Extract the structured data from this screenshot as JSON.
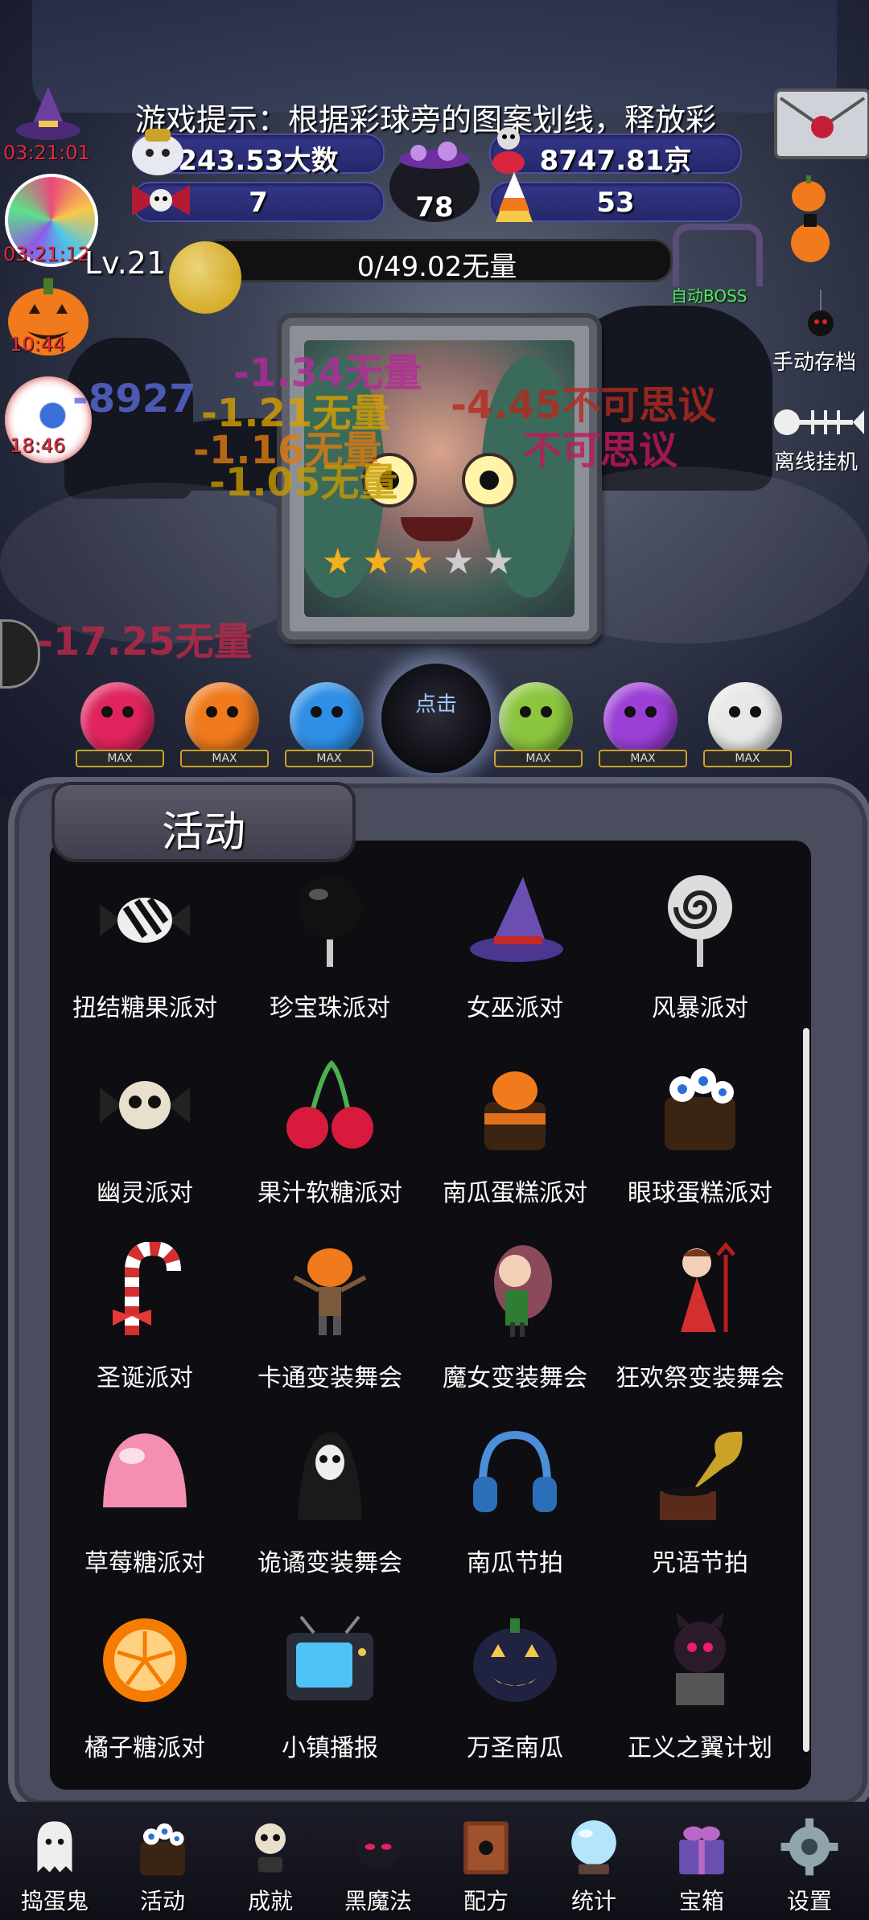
{
  "tip": "游戏提示：根据彩球旁的图案划线，释放彩",
  "timers": {
    "t1": "03:21:01",
    "t2": "03:21:12",
    "t3": "10:44",
    "t4": "18:46"
  },
  "stats": {
    "gold": "243.53大数",
    "souls": "8747.81京",
    "bows": "7",
    "cauldron": "78",
    "candy": "53"
  },
  "level": {
    "label": "Lv.21",
    "progress_text": "0/49.02无量",
    "progress_fraction": 0
  },
  "right_buttons": {
    "auto_boss": "自动BOSS",
    "manual_save": "手动存档",
    "offline": "离线挂机"
  },
  "damage_texts": [
    "-1.34无量",
    "-8927",
    "-1.21无量",
    "-1.16无量",
    "不可思议",
    "-1.05无量",
    "-4.45不可思议",
    "-17.25无量"
  ],
  "bubbles": [
    {
      "color": "#e0245e",
      "tag": "MAX"
    },
    {
      "color": "#f07a1c",
      "tag": "MAX"
    },
    {
      "color": "#2f8fe6",
      "tag": "MAX"
    },
    {
      "color": "#8cc63f",
      "tag": "MAX"
    },
    {
      "color": "#9b3fd6",
      "tag": "MAX"
    },
    {
      "color": "#e8e8e8",
      "tag": "MAX"
    }
  ],
  "click_button": "点击",
  "panel": {
    "title": "活动",
    "items": [
      {
        "label": "扭结糖果派对",
        "icon": "twist-candy-icon"
      },
      {
        "label": "珍宝珠派对",
        "icon": "black-lollipop-icon"
      },
      {
        "label": "女巫派对",
        "icon": "witch-hat-icon"
      },
      {
        "label": "风暴派对",
        "icon": "swirl-lollipop-icon"
      },
      {
        "label": "幽灵派对",
        "icon": "skull-candy-icon"
      },
      {
        "label": "果汁软糖派对",
        "icon": "cherry-icon"
      },
      {
        "label": "南瓜蛋糕派对",
        "icon": "pumpkin-cake-icon"
      },
      {
        "label": "眼球蛋糕派对",
        "icon": "eyeball-cake-icon"
      },
      {
        "label": "圣诞派对",
        "icon": "candy-cane-icon"
      },
      {
        "label": "卡通变装舞会",
        "icon": "pumpkin-man-icon"
      },
      {
        "label": "魔女变装舞会",
        "icon": "witch-girl-icon"
      },
      {
        "label": "狂欢祭变装舞会",
        "icon": "devil-girl-icon"
      },
      {
        "label": "草莓糖派对",
        "icon": "strawberry-jelly-icon"
      },
      {
        "label": "诡谲变装舞会",
        "icon": "reaper-icon"
      },
      {
        "label": "南瓜节拍",
        "icon": "headphones-icon"
      },
      {
        "label": "咒语节拍",
        "icon": "gramophone-icon"
      },
      {
        "label": "橘子糖派对",
        "icon": "orange-candy-icon"
      },
      {
        "label": "小镇播报",
        "icon": "tv-icon"
      },
      {
        "label": "万圣南瓜",
        "icon": "jack-o-lantern-icon"
      },
      {
        "label": "正义之翼计划",
        "icon": "demon-statue-icon"
      }
    ]
  },
  "nav": [
    {
      "label": "捣蛋鬼",
      "icon": "ghost-icon"
    },
    {
      "label": "活动",
      "icon": "eyeball-cake-icon"
    },
    {
      "label": "成就",
      "icon": "skull-trophy-icon"
    },
    {
      "label": "黑魔法",
      "icon": "demon-icon"
    },
    {
      "label": "配方",
      "icon": "spellbook-icon"
    },
    {
      "label": "统计",
      "icon": "crystal-ball-icon"
    },
    {
      "label": "宝箱",
      "icon": "gift-box-icon"
    },
    {
      "label": "设置",
      "icon": "gear-icon"
    }
  ]
}
